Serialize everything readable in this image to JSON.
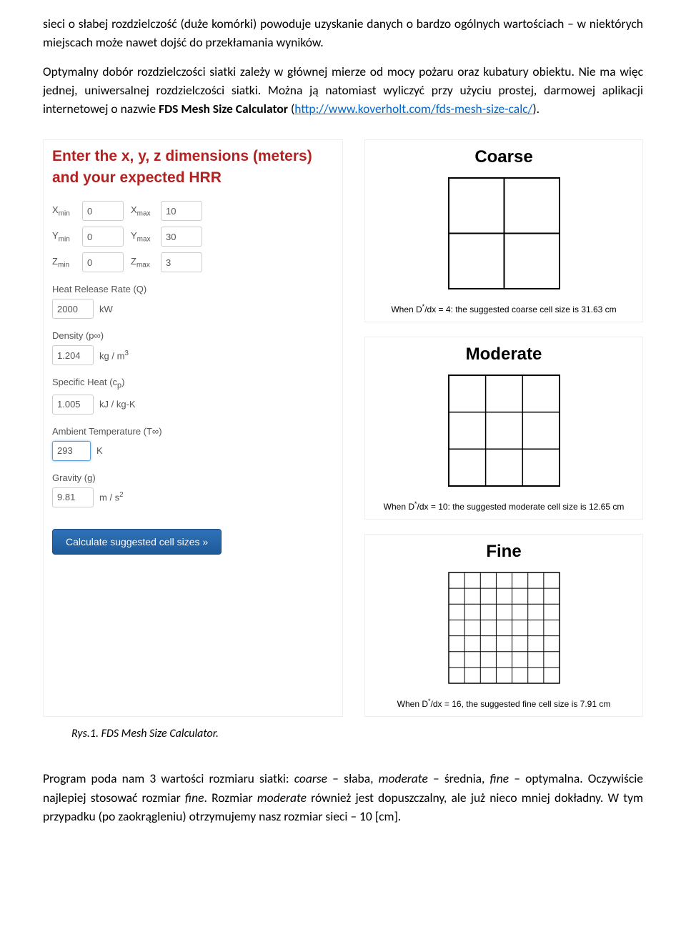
{
  "para1": "sieci o słabej rozdzielczość (duże komórki) powoduje uzyskanie danych o bardzo ogólnych wartościach – w niektórych miejscach może nawet dojść do przekłamania wyników.",
  "para2_pre": "Optymalny dobór rozdzielczości siatki zależy w głównej mierze od mocy pożaru oraz kubatury obiektu. Nie ma więc jednej, uniwersalnej rozdzielczości siatki. Można ją natomiast wyliczyć przy użyciu prostej, darmowej aplikacji internetowej o nazwie ",
  "para2_bold": "FDS Mesh Size Calculator",
  "para2_open": " (",
  "para2_link": "http://www.koverholt.com/fds-mesh-size-calc/",
  "para2_close": ").",
  "panel": {
    "title": "Enter the x, y, z dimensions (meters) and your expected HRR",
    "xmin_label": "Xmin",
    "xmin": "0",
    "xmax_label": "Xmax",
    "xmax": "10",
    "ymin_label": "Ymin",
    "ymin": "0",
    "ymax_label": "Ymax",
    "ymax": "30",
    "zmin_label": "Zmin",
    "zmin": "0",
    "zmax_label": "Zmax",
    "zmax": "3",
    "hrr_label": "Heat Release Rate (Q)",
    "hrr": "2000",
    "hrr_unit": "kW",
    "density_label": "Density (p∞)",
    "density": "1.204",
    "density_unit_pre": "kg / m",
    "density_unit_sup": "3",
    "cp_label": "Specific Heat (cp)",
    "cp": "1.005",
    "cp_unit": "kJ / kg-K",
    "temp_label": "Ambient Temperature (T∞)",
    "temp": "293",
    "temp_unit": "K",
    "grav_label": "Gravity (g)",
    "grav": "9.81",
    "grav_unit_pre": "m / s",
    "grav_unit_sup": "2",
    "button": "Calculate suggested cell sizes »"
  },
  "grids": {
    "coarse_title": "Coarse",
    "coarse_caption_pre": "When D*/dx = 4: the suggested coarse cell size is ",
    "coarse_caption_val": "31.63 cm",
    "moderate_title": "Moderate",
    "moderate_caption_pre": "When D*/dx = 10: the suggested moderate cell size is ",
    "moderate_caption_val": "12.65 cm",
    "fine_title": "Fine",
    "fine_caption_pre": "When D*/dx = 16, the suggested fine cell size is ",
    "fine_caption_val": "7.91 cm"
  },
  "fig_caption": "Rys.1. FDS Mesh Size Calculator.",
  "para3_pre": "Program poda nam 3 wartości rozmiaru siatki: ",
  "para3_coarse": "coarse",
  "para3_coarse_desc": " – słaba, ",
  "para3_moderate": "moderate",
  "para3_moderate_desc": " – średnia, ",
  "para3_fine": "fine",
  "para3_fine_desc": " – optymalna. Oczywiście najlepiej stosować rozmiar ",
  "para3_fine2": "fine",
  "para3_mid": ". Rozmiar ",
  "para3_moderate2": "moderate",
  "para3_end": " również jest dopuszczalny, ale już nieco mniej dokładny. W tym przypadku (po zaokrągleniu) otrzymujemy nasz rozmiar sieci – 10 [cm]."
}
